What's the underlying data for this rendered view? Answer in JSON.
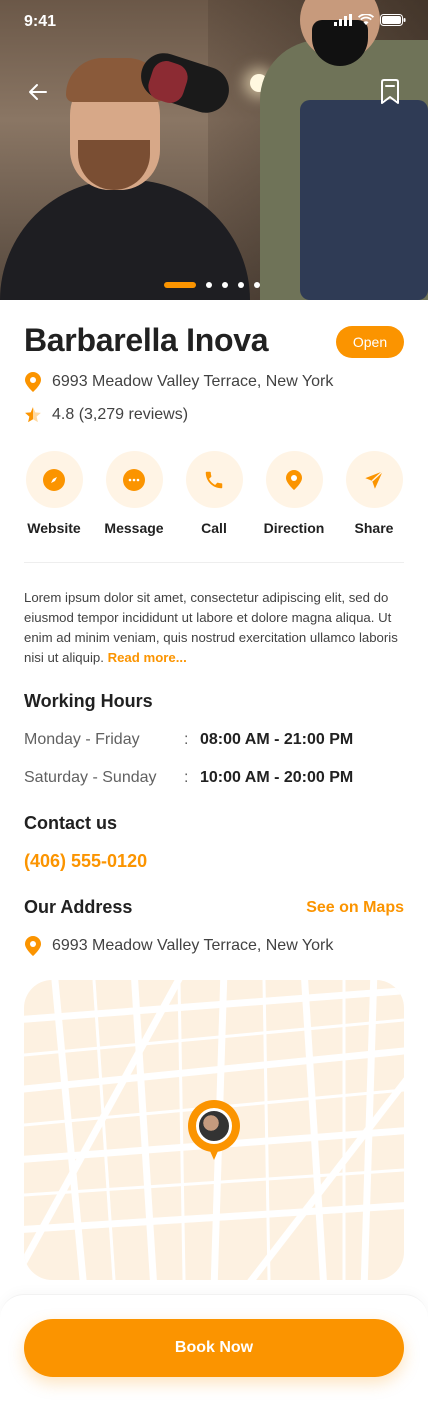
{
  "status_bar": {
    "time": "9:41"
  },
  "hero": {
    "carousel_pages": 5,
    "active_page": 1
  },
  "shop": {
    "name": "Barbarella Inova",
    "status": "Open",
    "address": "6993 Meadow Valley Terrace, New York",
    "rating_text": "4.8 (3,279 reviews)",
    "rating": 4.8,
    "reviews": "3,279"
  },
  "actions": [
    {
      "label": "Website",
      "icon": "compass-icon"
    },
    {
      "label": "Message",
      "icon": "chat-icon"
    },
    {
      "label": "Call",
      "icon": "phone-icon"
    },
    {
      "label": "Direction",
      "icon": "location-icon"
    },
    {
      "label": "Share",
      "icon": "send-icon"
    }
  ],
  "description": {
    "text": "Lorem ipsum dolor sit amet, consectetur adipiscing elit, sed do eiusmod tempor incididunt ut labore et dolore magna aliqua. Ut enim ad minim veniam, quis nostrud exercitation ullamco laboris nisi ut aliquip.",
    "read_more": "Read more..."
  },
  "working_hours": {
    "title": "Working Hours",
    "rows": [
      {
        "days": "Monday - Friday",
        "sep": ":",
        "time": "08:00 AM - 21:00 PM"
      },
      {
        "days": "Saturday - Sunday",
        "sep": ":",
        "time": "10:00 AM - 20:00 PM"
      }
    ]
  },
  "contact": {
    "title": "Contact us",
    "phone": "(406) 555-0120"
  },
  "our_address": {
    "title": "Our Address",
    "see_maps": "See on Maps",
    "address": "6993 Meadow Valley Terrace, New York"
  },
  "cta": {
    "label": "Book Now"
  },
  "colors": {
    "accent": "#FB9400",
    "accent_light": "#FFF4E5",
    "text": "#212121",
    "muted": "#616161"
  }
}
